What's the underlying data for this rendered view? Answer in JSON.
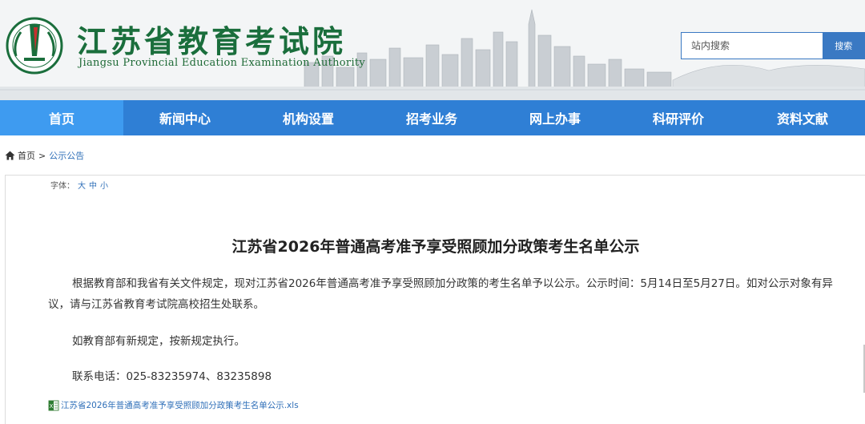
{
  "header": {
    "title": "江苏省教育考试院",
    "subtitle": "Jiangsu Provincial Education Examination Authority",
    "logo_icon": "provincial-emblem-icon"
  },
  "search": {
    "placeholder": "站内搜索",
    "button_label": "搜索"
  },
  "nav": {
    "items": [
      {
        "label": "首页"
      },
      {
        "label": "新闻中心"
      },
      {
        "label": "机构设置"
      },
      {
        "label": "招考业务"
      },
      {
        "label": "网上办事"
      },
      {
        "label": "科研评价"
      },
      {
        "label": "资料文献"
      }
    ],
    "active_index": 0
  },
  "breadcrumb": {
    "home": "首页",
    "separator": ">",
    "current": "公示公告"
  },
  "font_size": {
    "label": "字体：",
    "large": "大",
    "medium": "中",
    "small": "小"
  },
  "article": {
    "title": "江苏省2026年普通高考准予享受照顾加分政策考生名单公示",
    "paragraph1": "根据教育部和我省有关文件规定，现对江苏省2026年普通高考准予享受照顾加分政策的考生名单予以公示。公示时间：5月14日至5月27日。如对公示对象有异议，请与江苏省教育考试院高校招生处联系。",
    "paragraph2": "如教育部有新规定，按新规定执行。",
    "paragraph3": "联系电话：025-83235974、83235898",
    "attachment": "江苏省2026年普通高考准予享受照顾加分政策考生名单公示.xls"
  },
  "colors": {
    "nav_bg": "#2f7fd5",
    "nav_active": "#3e9bf0",
    "title_green": "#1a6e3c",
    "link_blue": "#2f6fb8"
  }
}
